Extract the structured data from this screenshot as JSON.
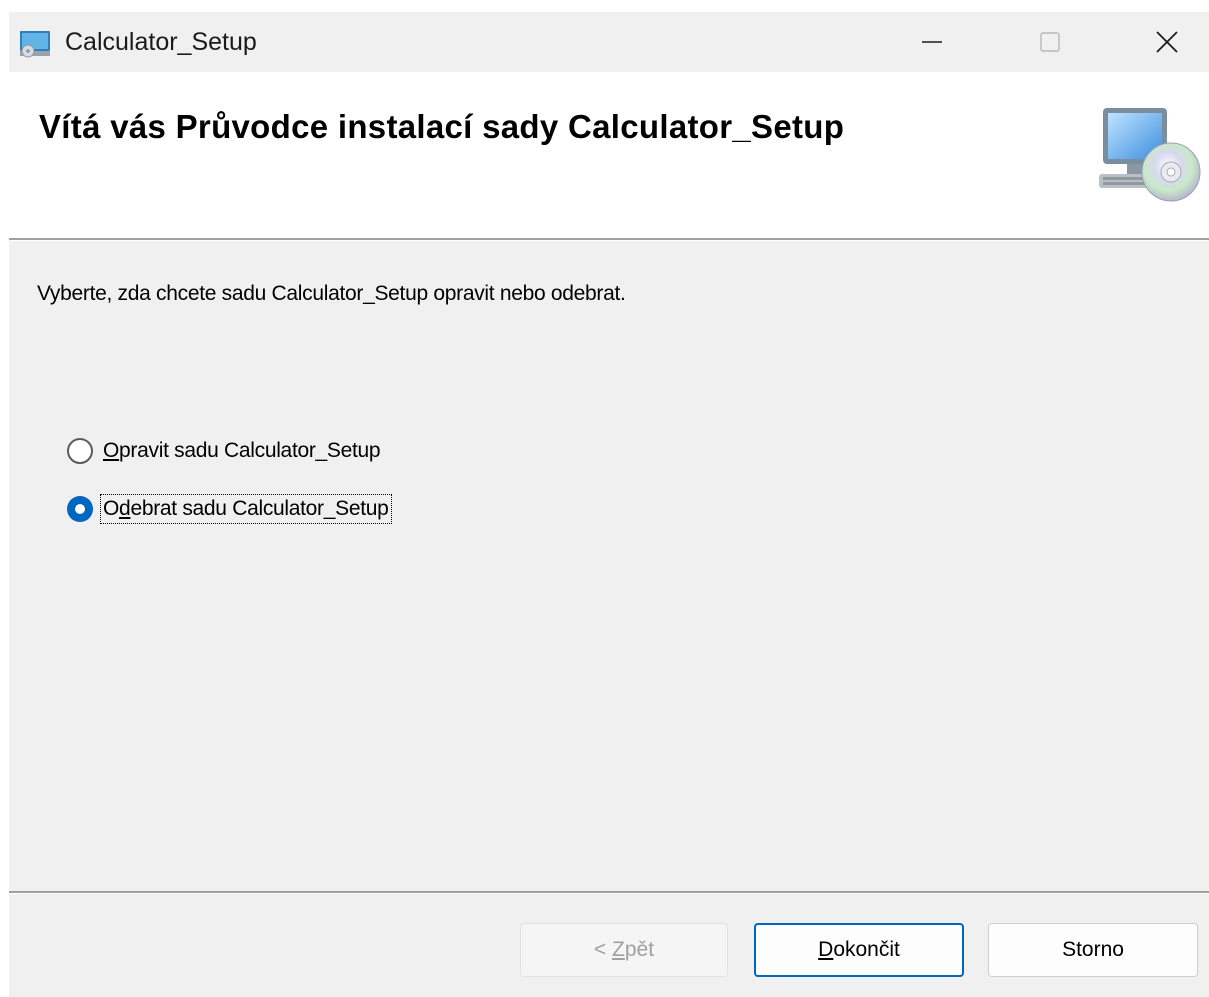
{
  "window": {
    "title": "Calculator_Setup"
  },
  "banner": {
    "title": "Vítá vás Průvodce instalací sady Calculator_Setup"
  },
  "body": {
    "instruction": "Vyberte, zda chcete sadu Calculator_Setup opravit nebo odebrat.",
    "options": [
      {
        "access_key": "O",
        "label_rest": "pravit sadu Calculator_Setup",
        "selected": false
      },
      {
        "label_prefix": "O",
        "access_key": "d",
        "label_rest": "ebrat sadu Calculator_Setup",
        "selected": true
      }
    ]
  },
  "buttons": {
    "back": {
      "prefix": "< ",
      "access_key": "Z",
      "rest": "pět",
      "enabled": false
    },
    "finish": {
      "access_key": "D",
      "rest": "okončit"
    },
    "cancel": {
      "label": "Storno"
    }
  },
  "colors": {
    "accent": "#0067c0",
    "window_bg": "#f0f0f0",
    "banner_bg": "#ffffff",
    "disabled_text": "#a0a0a0"
  },
  "icons": {
    "app": "installer-computer-icon",
    "banner": "computer-cd-icon",
    "minimize": "minimize-icon",
    "maximize": "maximize-icon",
    "close": "close-icon"
  }
}
